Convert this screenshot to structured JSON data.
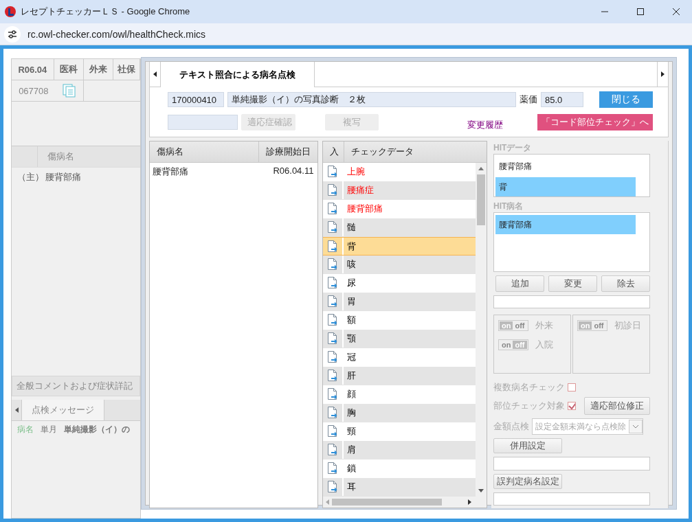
{
  "browser": {
    "title": "レセプトチェッカーＬＳ - Google Chrome",
    "url": "rc.owl-checker.com/owl/healthCheck.mics"
  },
  "background": {
    "header_cells": [
      "R06.04",
      "医科",
      "外来",
      "社保"
    ],
    "receipt_no": "067708",
    "disease_column": "傷病名",
    "disease_rows": [
      {
        "prefix": "（主）",
        "name": "腰背部痛"
      }
    ],
    "comment_header": "全般コメントおよび症状詳記",
    "tabs": [
      {
        "label": "点検メッセージ",
        "selected": true
      }
    ],
    "message": {
      "category": "病名",
      "period": "単月",
      "text": "単純撮影（イ）の"
    }
  },
  "dialog": {
    "tabs": [
      {
        "label": "テキスト照合による病名点検",
        "selected": true
      }
    ],
    "code": "170000410",
    "item_name": "単純撮影（イ）の写真診断　２枚",
    "price_label": "薬価",
    "price": "85.0",
    "close_button": "閉じる",
    "indication_button": {
      "label": "適応症確認",
      "disabled": true
    },
    "copy_button": {
      "label": "複写",
      "disabled": true
    },
    "history_link": "変更履歴",
    "code_check_button": "「コード部位チェック」へ",
    "disease_table": {
      "columns": [
        "傷病名",
        "診療開始日"
      ],
      "rows": [
        {
          "name": "腰背部痛",
          "start_date": "R06.04.11"
        }
      ]
    },
    "check_data": {
      "columns": [
        "入",
        "チェックデータ"
      ],
      "rows": [
        {
          "text": "上腕",
          "matched": true,
          "selected": false
        },
        {
          "text": "腰痛症",
          "matched": true,
          "selected": false
        },
        {
          "text": "腰背部痛",
          "matched": true,
          "selected": false
        },
        {
          "text": "髄",
          "matched": false,
          "selected": false
        },
        {
          "text": "背",
          "matched": false,
          "selected": true
        },
        {
          "text": "咳",
          "matched": false,
          "selected": false
        },
        {
          "text": "尿",
          "matched": false,
          "selected": false
        },
        {
          "text": "胃",
          "matched": false,
          "selected": false
        },
        {
          "text": "額",
          "matched": false,
          "selected": false
        },
        {
          "text": "顎",
          "matched": false,
          "selected": false
        },
        {
          "text": "冠",
          "matched": false,
          "selected": false
        },
        {
          "text": "肝",
          "matched": false,
          "selected": false
        },
        {
          "text": "顔",
          "matched": false,
          "selected": false
        },
        {
          "text": "胸",
          "matched": false,
          "selected": false
        },
        {
          "text": "頸",
          "matched": false,
          "selected": false
        },
        {
          "text": "肩",
          "matched": false,
          "selected": false
        },
        {
          "text": "鎖",
          "matched": false,
          "selected": false
        },
        {
          "text": "耳",
          "matched": false,
          "selected": false
        }
      ]
    },
    "hit_data": {
      "label": "HITデータ",
      "items": [
        {
          "text": "腰背部痛",
          "selected": false
        },
        {
          "text": "背",
          "selected": true
        }
      ]
    },
    "hit_disease": {
      "label": "HIT病名",
      "items": [
        {
          "text": "腰背部痛",
          "selected": true
        }
      ]
    },
    "edit_buttons": [
      "追加",
      "変更",
      "除去"
    ],
    "toggle_groups": [
      {
        "toggles": [
          {
            "label": "外来",
            "on_text": "on",
            "off_text": "off",
            "on": true
          },
          {
            "label": "入院",
            "on_text": "on",
            "off_text": "off",
            "on": false
          }
        ]
      },
      {
        "toggles": [
          {
            "label": "初診日",
            "on_text": "on",
            "off_text": "off",
            "on": true
          }
        ]
      }
    ],
    "multi_check": {
      "label": "複数病名チェック",
      "checked": false
    },
    "site_check": {
      "label": "部位チェック対象",
      "checked": true
    },
    "site_fix_button": "適応部位修正",
    "amount_check": {
      "label": "金額点検",
      "value": "設定金額未満なら点検除"
    },
    "combo_button": "併用設定",
    "misjudge_button": "誤判定病名設定"
  }
}
